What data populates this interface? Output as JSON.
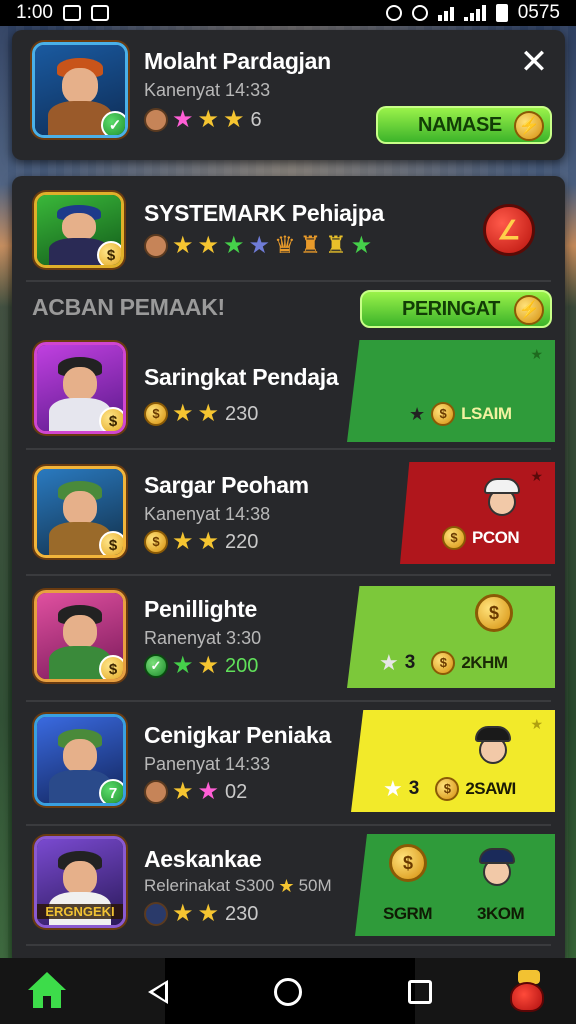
{
  "status_bar": {
    "time": "1:00",
    "right_text": "0575"
  },
  "top_card": {
    "name": "Molaht Pardagjan",
    "subtitle": "Kanenyat 14:33",
    "stat_value": "6",
    "button_label": "NAMASE",
    "close_icon": "close-icon"
  },
  "featured": {
    "name": "SYSTEMARK Pehiajpa"
  },
  "section": {
    "title": "ACBAN PEMAAK!",
    "button_label": "PERINGAT"
  },
  "rows": [
    {
      "name": "Saringkat Pendaja",
      "subtitle": "",
      "stat_value": "230",
      "panel_color": "#2f9b3a",
      "panel_label": "LSAIM"
    },
    {
      "name": "Sargar Peoham",
      "subtitle": "Kanenyat 14:38",
      "stat_value": "220",
      "panel_color": "#b0161c",
      "panel_label": "PCON"
    },
    {
      "name": "Penillighte",
      "subtitle": "Ranenyat 3:30",
      "stat_value": "200",
      "panel_color": "#7cc83a",
      "panel_star_count": "3",
      "panel_label": "2KHM"
    },
    {
      "name": "Cenigkar Peniaka",
      "subtitle": "Panenyat 14:33",
      "stat_value": "02",
      "panel_color": "#f2ea2a",
      "panel_star_count": "3",
      "panel_label": "2SAWI"
    },
    {
      "name": "Aeskankae",
      "subtitle": "Relerinakat S300",
      "subtitle_extra": "50M",
      "stat_value": "230",
      "avatar_tag": "ERGNGEKI",
      "panel_color": "#2f9b3a",
      "panel_label_left": "SGRM",
      "panel_label": "3KOM"
    }
  ],
  "colors": {
    "card_bg": "#27282b",
    "accent_green": "#3cb32a",
    "gold": "#f5c531"
  }
}
